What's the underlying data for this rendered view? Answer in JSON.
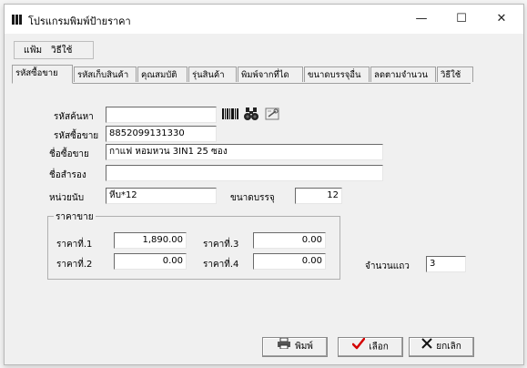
{
  "window": {
    "title": "โปรแกรมพิมพ์ป้ายราคา",
    "minimize": "—",
    "maximize": "☐",
    "close": "✕"
  },
  "menu": {
    "items": [
      "แฟ้ม",
      "วิธีใช้"
    ]
  },
  "tabs": [
    "รหัสซื้อขาย",
    "รหัสเก็บสินค้า",
    "คุณสมบัติ",
    "รุ่นสินค้า",
    "พิมพ์จากที่ได",
    "ขนาดบรรจุอื่น",
    "ลดตามจำนวน",
    "วิธีใช้"
  ],
  "form": {
    "search_label": "รหัสค้นหา",
    "search_value": "",
    "barcode_label": "รหัสซื้อขาย",
    "barcode_value": "8852099131330",
    "name_label": "ชื่อซื้อขาย",
    "name_value": "กาแฟ หอมหวน 3IN1 25 ซอง",
    "alt_label": "ชื่อสำรอง",
    "alt_value": "",
    "unit_label": "หน่วยนับ",
    "unit_value": "หีบ*12",
    "pack_label": "ขนาดบรรจุ",
    "pack_value": "12"
  },
  "prices": {
    "group_title": "ราคาขาย",
    "p1_label": "ราคาที่.1",
    "p1_value": "1,890.00",
    "p2_label": "ราคาที่.2",
    "p2_value": "0.00",
    "p3_label": "ราคาที่.3",
    "p3_value": "0.00",
    "p4_label": "ราคาที่.4",
    "p4_value": "0.00"
  },
  "rows": {
    "label": "จำนวนแถว",
    "value": "3"
  },
  "buttons": {
    "print": "พิมพ์",
    "select": "เลือก",
    "cancel": "ยกเลิก"
  },
  "icons": [
    "barcode-icon",
    "binoculars-icon",
    "tool-icon",
    "printer-icon",
    "checkmark-icon",
    "x-icon"
  ],
  "colors": {
    "check": "#d40000",
    "window_bg": "#f0f0f0"
  }
}
